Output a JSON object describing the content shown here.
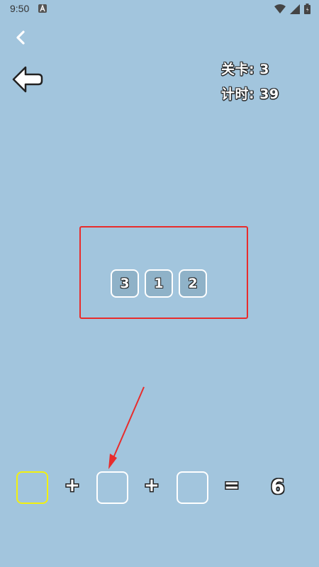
{
  "status_bar": {
    "time": "9:50"
  },
  "hud": {
    "level_text": "关卡: 3",
    "timer_text": "计时: 39"
  },
  "pool_tiles": [
    "3",
    "1",
    "2"
  ],
  "equation": {
    "plus_1": "+",
    "plus_2": "+",
    "equals": "=",
    "target": "6"
  },
  "colors": {
    "background": "#a2c5dd",
    "highlight_box": "#e82c2c",
    "active_slot": "#f3f10e",
    "arrow": "#e82c2c"
  }
}
